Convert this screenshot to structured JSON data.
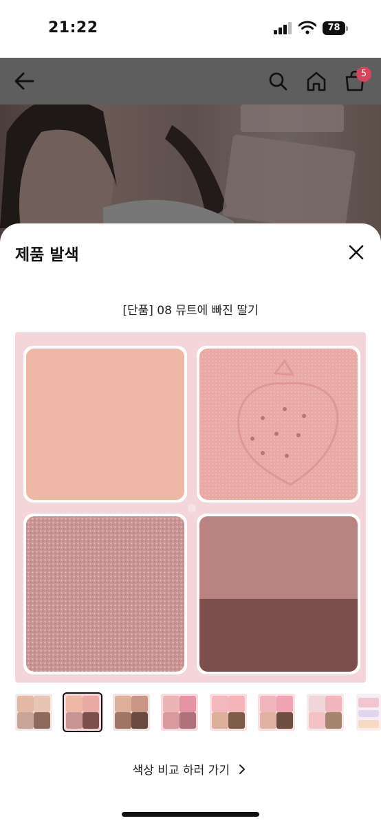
{
  "status_bar": {
    "time": "21:22",
    "battery": "78"
  },
  "header": {
    "cart_count": "5"
  },
  "sheet": {
    "title": "제품 발색",
    "shade_name": "[단품] 08 뮤트에 빠진 딸기",
    "compare_label": "색상 비교 하러 가기"
  },
  "colors": {
    "palette_frame": "#f3d5da",
    "pan_top_left": "#efb8a6",
    "pan_top_right": "#e9aaa5",
    "pan_bottom_left": "#c99493",
    "pan_bottom_right_top": "#b98381",
    "pan_bottom_right_bottom": "#7c4f4e"
  },
  "thumbnails": [
    {
      "colors": [
        "#e3b9a6",
        "#e8c4b5",
        "#caa597",
        "#8f6a5c"
      ],
      "selected": false
    },
    {
      "colors": [
        "#efb8a6",
        "#e9aaa5",
        "#c99493",
        "#7c4f4e"
      ],
      "selected": true
    },
    {
      "colors": [
        "#deb09c",
        "#c99584",
        "#a17566",
        "#6a4a40"
      ],
      "selected": false
    },
    {
      "colors": [
        "#ecb5b5",
        "#e694a4",
        "#d89a9f",
        "#b0727a"
      ],
      "selected": false
    },
    {
      "colors": [
        "#f2b8bd",
        "#f4b4b8",
        "#ddb09c",
        "#7d5d4a"
      ],
      "selected": false
    },
    {
      "colors": [
        "#f1b6bd",
        "#f0a4b3",
        "#e1b2a4",
        "#6e4e40"
      ],
      "selected": false
    },
    {
      "colors": [
        "#f0d6d8",
        "#f1b6bd",
        "#f4c1c4",
        "#a6856d"
      ],
      "selected": false
    }
  ]
}
